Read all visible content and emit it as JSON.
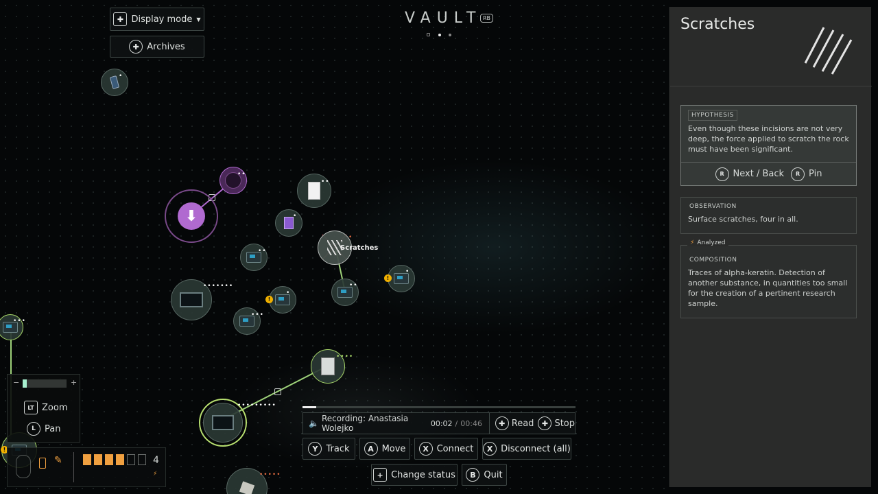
{
  "header": {
    "title": "VAULT",
    "bumper": "RB",
    "pager": [
      "lock",
      "active",
      "dot"
    ]
  },
  "top_left": {
    "display_mode_label": "Display mode",
    "archives_label": "Archives"
  },
  "nodes": {
    "scratches_label": "Scratches"
  },
  "controls": {
    "zoom_label": "Zoom",
    "zoom_key": "LT",
    "pan_label": "Pan",
    "pan_key": "L",
    "slider_minus": "−",
    "slider_plus": "+",
    "slider_level": 0.1
  },
  "hud": {
    "count": "4",
    "slots_filled": 4,
    "slots_total": 6
  },
  "audio": {
    "recording_label": "Recording: Anastasia Wolejko",
    "elapsed": "00:02",
    "separator": "/",
    "duration": "00:46",
    "progress": 0.05,
    "read_label": "Read",
    "stop_label": "Stop"
  },
  "actions": [
    {
      "key": "Y",
      "label": "Track"
    },
    {
      "key": "A",
      "label": "Move"
    },
    {
      "key": "X",
      "label": "Connect"
    },
    {
      "key": "X",
      "label": "Disconnect (all)"
    }
  ],
  "bottom_actions": [
    {
      "key": "+",
      "label": "Change status"
    },
    {
      "key": "B",
      "label": "Quit"
    }
  ],
  "panel": {
    "title": "Scratches",
    "hypothesis": {
      "tag": "HYPOTHESIS",
      "text": "Even though these incisions are not very deep, the force applied to scratch the rock must have been significant.",
      "next_back_key": "R",
      "next_back_label": "Next / Back",
      "pin_key": "R",
      "pin_label": "Pin"
    },
    "observation": {
      "tag": "OBSERVATION",
      "text": "Surface scratches, four in all."
    },
    "composition": {
      "badge": "Analyzed",
      "tag": "COMPOSITION",
      "text": "Traces of alpha-keratin. Detection of another substance, in quantities too small for the creation of a pertinent research sample."
    }
  },
  "colors": {
    "accent_green": "#a8d86a",
    "accent_purple": "#b06ad0",
    "warning": "#f0b000",
    "hud_orange": "#f0a040"
  }
}
